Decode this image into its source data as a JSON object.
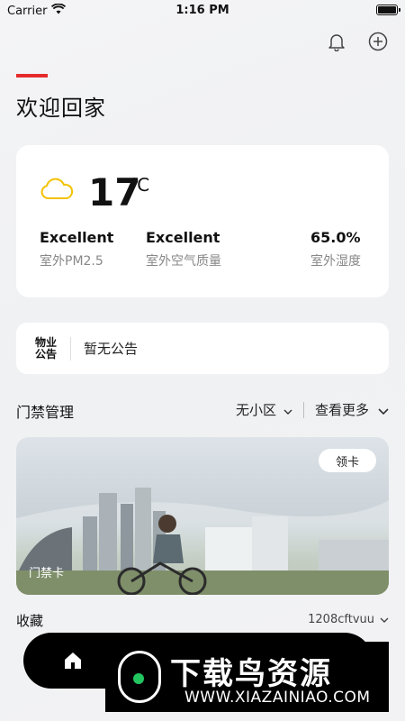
{
  "status_bar": {
    "carrier": "Carrier",
    "time": "1:16 PM"
  },
  "header": {
    "icons": [
      "bell-icon",
      "add-circle-icon"
    ],
    "welcome": "欢迎回家",
    "accent_color": "#e52b2b"
  },
  "weather": {
    "icon": "cloud-icon",
    "temperature": "17",
    "unit": "℃",
    "metrics": [
      {
        "value": "Excellent",
        "label": "室外PM2.5"
      },
      {
        "value": "Excellent",
        "label": "室外空气质量"
      },
      {
        "value": "65.0%",
        "label": "室外湿度"
      }
    ]
  },
  "notice": {
    "logo_text": "物业公告",
    "text": "暂无公告"
  },
  "access": {
    "title": "门禁管理",
    "community_select": "无小区",
    "more": "查看更多",
    "banner_badge": "领卡",
    "banner_caption": "门禁卡"
  },
  "favorites": {
    "title": "收藏",
    "account": "1208cftvuu"
  },
  "tab_bar": {
    "icons": [
      "home-icon"
    ]
  },
  "watermark": {
    "title": "下载鸟资源",
    "url": "WWW.XIAZAINIAO.COM"
  }
}
